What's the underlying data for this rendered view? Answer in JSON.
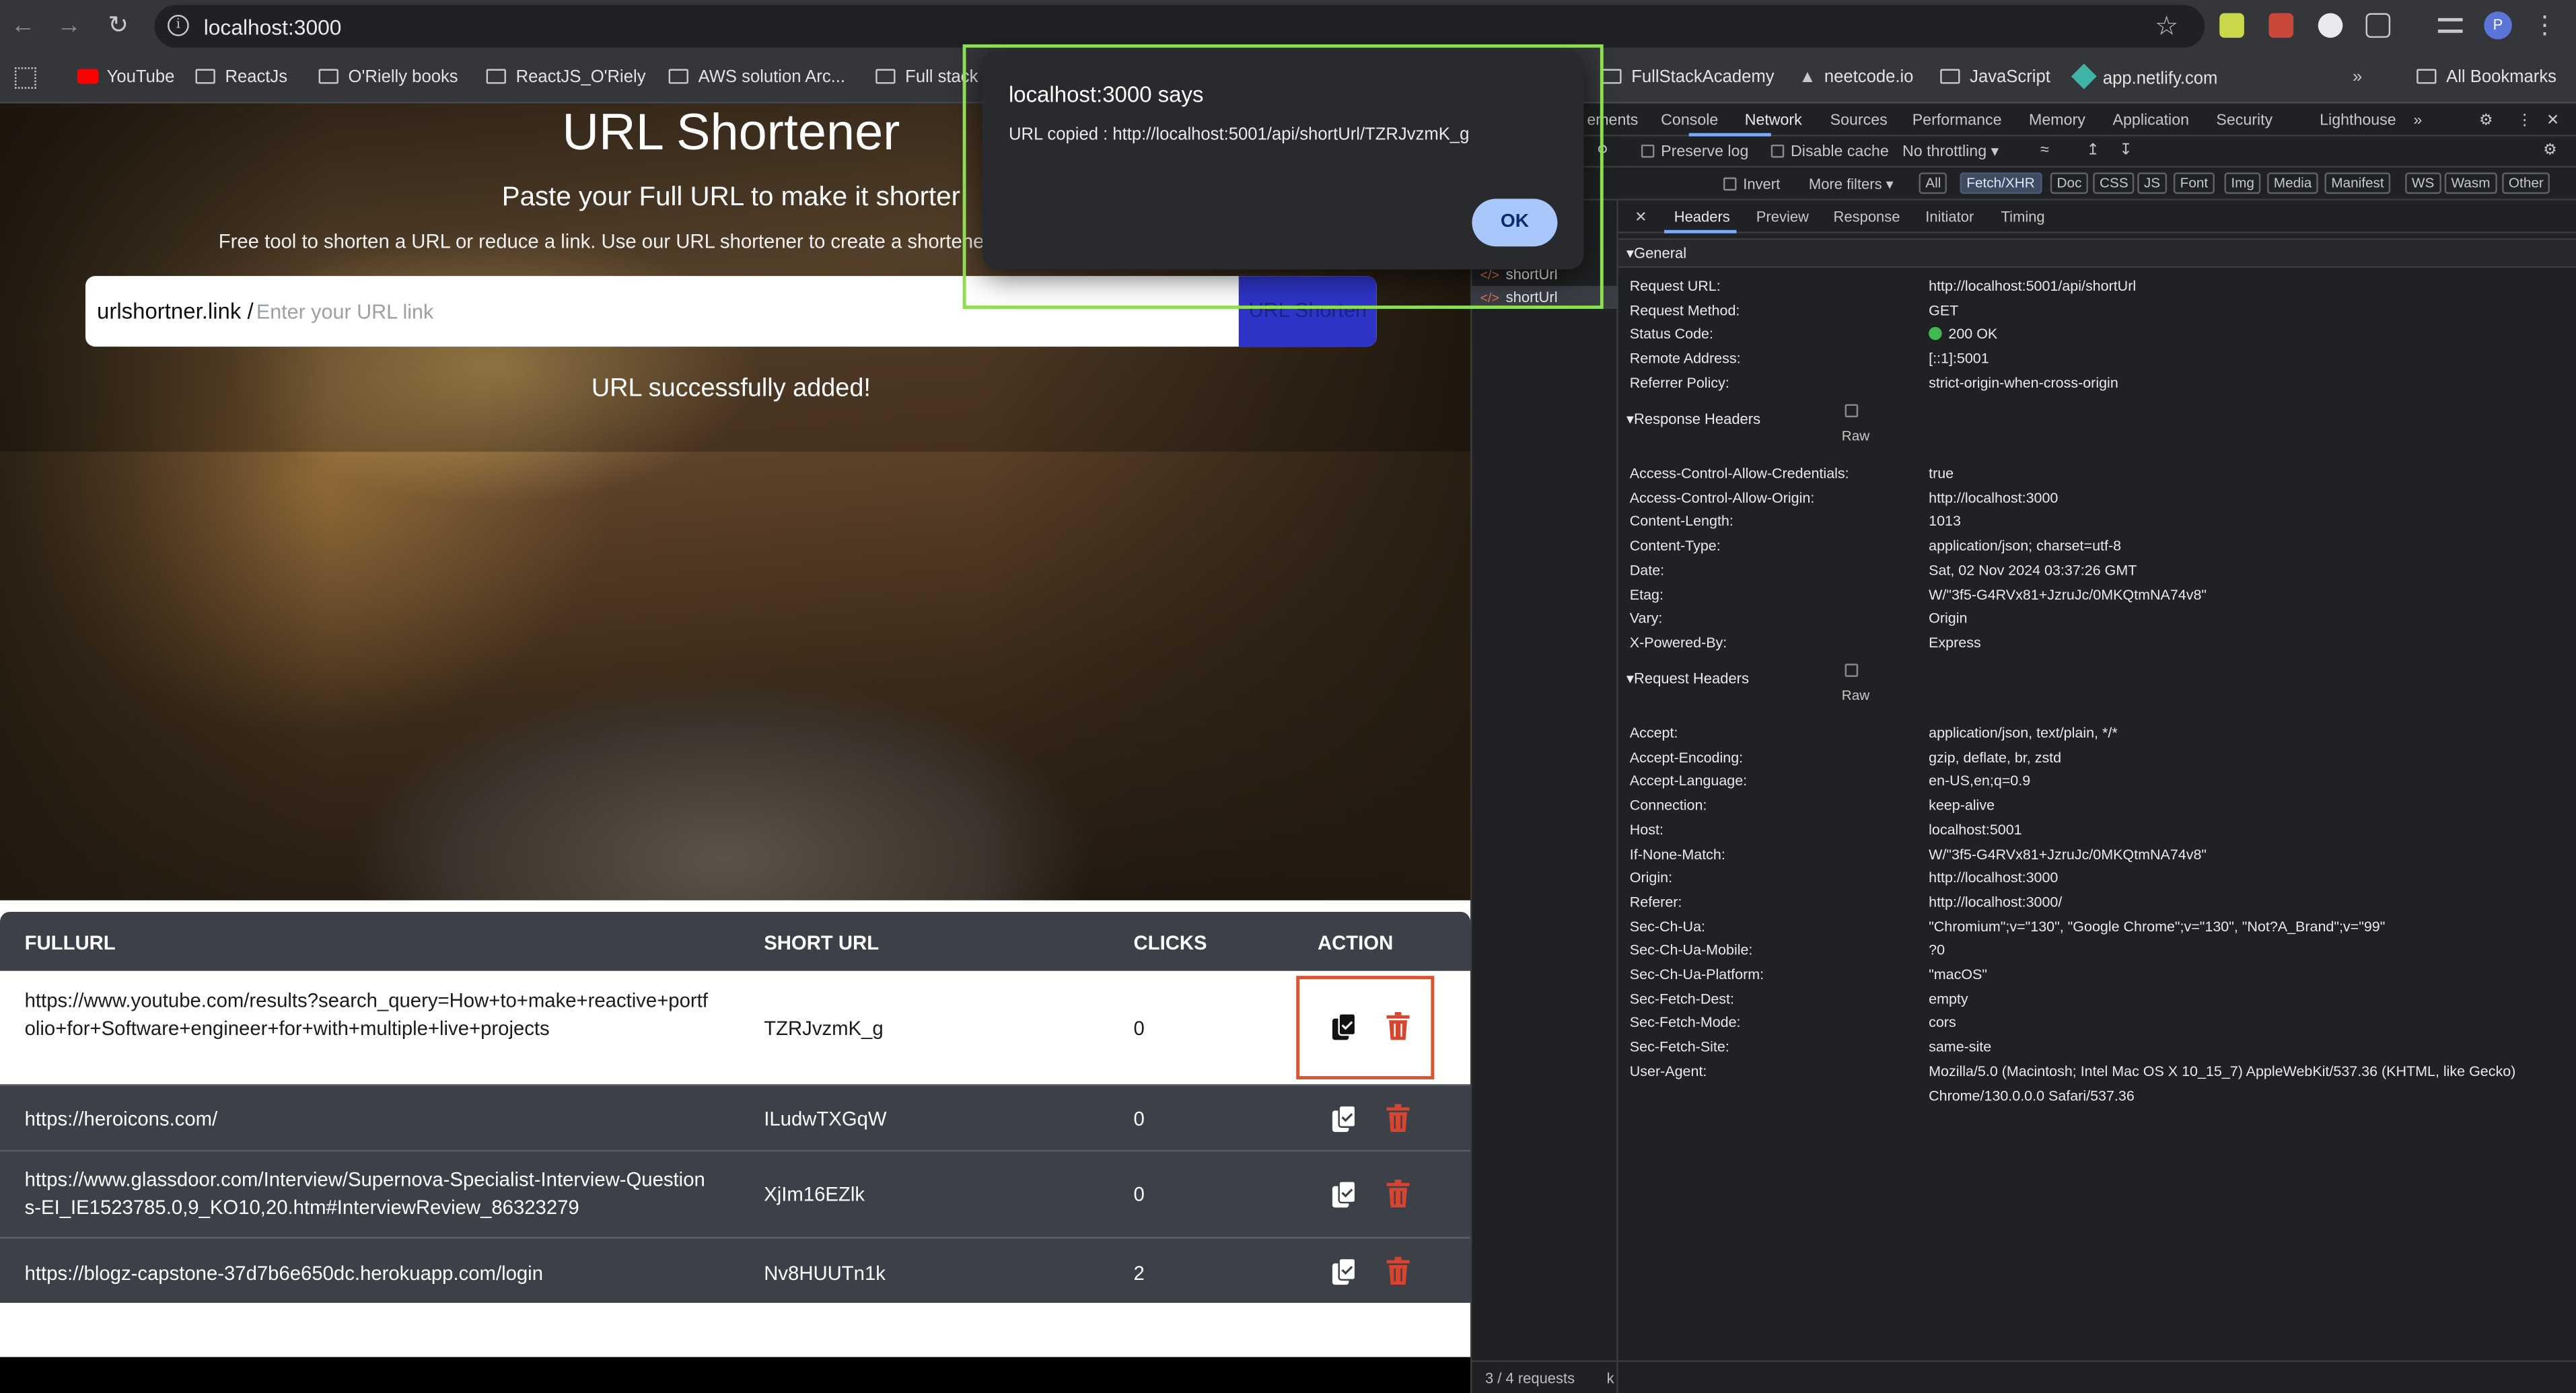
{
  "browser": {
    "url": "localhost:3000",
    "bookmarks": [
      {
        "label": "YouTube",
        "type": "youtube"
      },
      {
        "label": "ReactJs",
        "type": "folder"
      },
      {
        "label": "O'Rielly books",
        "type": "folder"
      },
      {
        "label": "ReactJS_O'Riely",
        "type": "folder"
      },
      {
        "label": "AWS solution Arc...",
        "type": "folder"
      },
      {
        "label": "Full stack",
        "type": "folder"
      },
      {
        "label": "FullStackAcademy",
        "type": "folder"
      },
      {
        "label": "neetcode.io",
        "type": "site"
      },
      {
        "label": "JavaScript",
        "type": "folder"
      },
      {
        "label": "app.netlify.com",
        "type": "site"
      }
    ],
    "all_bookmarks": "All Bookmarks",
    "profile_initial": "P"
  },
  "app": {
    "title": "URL Shortener",
    "subtitle": "Paste your Full URL to make it shorter",
    "description": "Free tool to shorten a URL or reduce a link. Use our URL shortener to create a shortened &",
    "domain_prefix": "urlshortner.link /",
    "input_placeholder": "Enter your URL link",
    "submit_label": "URL Shorten",
    "status_message": "URL successfully added!",
    "table": {
      "headers": [
        "FULLURL",
        "SHORT URL",
        "CLICKS",
        "ACTION"
      ],
      "rows": [
        {
          "full_url": "https://www.youtube.com/results?search_query=How+to+make+reactive+portfolio+for+Software+engineer+for+with+multiple+live+projects",
          "short_url": "TZRJvzmK_g",
          "clicks": "0"
        },
        {
          "full_url": "https://heroicons.com/",
          "short_url": "ILudwTXGqW",
          "clicks": "0"
        },
        {
          "full_url": "https://www.glassdoor.com/Interview/Supernova-Specialist-Interview-Questions-EI_IE1523785.0,9_KO10,20.htm#InterviewReview_86323279",
          "short_url": "XjIm16EZlk",
          "clicks": "0"
        },
        {
          "full_url": "https://blogz-capstone-37d7b6e650dc.herokuapp.com/login",
          "short_url": "Nv8HUUTn1k",
          "clicks": "2"
        }
      ]
    }
  },
  "dialog": {
    "title": "localhost:3000 says",
    "message": "URL copied : http://localhost:5001/api/shortUrl/TZRJvzmK_g",
    "ok_label": "OK"
  },
  "devtools": {
    "tabs": [
      "ements",
      "Console",
      "Network",
      "Sources",
      "Performance",
      "Memory",
      "Application",
      "Security",
      "Lighthouse"
    ],
    "active_tab": "Network",
    "toolbar": {
      "preserve_log": "Preserve log",
      "disable_cache": "Disable cache",
      "throttling": "No throttling"
    },
    "filter_bar": {
      "invert": "Invert",
      "more_filters": "More filters",
      "types": [
        "All",
        "Fetch/XHR",
        "Doc",
        "CSS",
        "JS",
        "Font",
        "Img",
        "Media",
        "Manifest",
        "WS",
        "Wasm",
        "Other"
      ],
      "active_type": "Fetch/XHR"
    },
    "requests": [
      {
        "name": "shortUrl",
        "selected": false
      },
      {
        "name": "shortUrl",
        "selected": true
      }
    ],
    "footer": "3 / 4 requests",
    "footer_tail": "k",
    "detail_tabs": [
      "Headers",
      "Preview",
      "Response",
      "Initiator",
      "Timing"
    ],
    "active_detail_tab": "Headers",
    "general": {
      "title": "General",
      "items": [
        {
          "k": "Request URL:",
          "v": "http://localhost:5001/api/shortUrl"
        },
        {
          "k": "Request Method:",
          "v": "GET"
        },
        {
          "k": "Status Code:",
          "v": "200 OK"
        },
        {
          "k": "Remote Address:",
          "v": "[::1]:5001"
        },
        {
          "k": "Referrer Policy:",
          "v": "strict-origin-when-cross-origin"
        }
      ]
    },
    "response_headers": {
      "title": "Response Headers",
      "raw_label": "Raw",
      "items": [
        {
          "k": "Access-Control-Allow-Credentials:",
          "v": "true"
        },
        {
          "k": "Access-Control-Allow-Origin:",
          "v": "http://localhost:3000"
        },
        {
          "k": "Content-Length:",
          "v": "1013"
        },
        {
          "k": "Content-Type:",
          "v": "application/json; charset=utf-8"
        },
        {
          "k": "Date:",
          "v": "Sat, 02 Nov 2024 03:37:26 GMT"
        },
        {
          "k": "Etag:",
          "v": "W/\"3f5-G4RVx81+JzruJc/0MKQtmNA74v8\""
        },
        {
          "k": "Vary:",
          "v": "Origin"
        },
        {
          "k": "X-Powered-By:",
          "v": "Express"
        }
      ]
    },
    "request_headers": {
      "title": "Request Headers",
      "raw_label": "Raw",
      "items": [
        {
          "k": "Accept:",
          "v": "application/json, text/plain, */*"
        },
        {
          "k": "Accept-Encoding:",
          "v": "gzip, deflate, br, zstd"
        },
        {
          "k": "Accept-Language:",
          "v": "en-US,en;q=0.9"
        },
        {
          "k": "Connection:",
          "v": "keep-alive"
        },
        {
          "k": "Host:",
          "v": "localhost:5001"
        },
        {
          "k": "If-None-Match:",
          "v": "W/\"3f5-G4RVx81+JzruJc/0MKQtmNA74v8\""
        },
        {
          "k": "Origin:",
          "v": "http://localhost:3000"
        },
        {
          "k": "Referer:",
          "v": "http://localhost:3000/"
        },
        {
          "k": "Sec-Ch-Ua:",
          "v": "\"Chromium\";v=\"130\", \"Google Chrome\";v=\"130\", \"Not?A_Brand\";v=\"99\""
        },
        {
          "k": "Sec-Ch-Ua-Mobile:",
          "v": "?0"
        },
        {
          "k": "Sec-Ch-Ua-Platform:",
          "v": "\"macOS\""
        },
        {
          "k": "Sec-Fetch-Dest:",
          "v": "empty"
        },
        {
          "k": "Sec-Fetch-Mode:",
          "v": "cors"
        },
        {
          "k": "Sec-Fetch-Site:",
          "v": "same-site"
        },
        {
          "k": "User-Agent:",
          "v": "Mozilla/5.0 (Macintosh; Intel Mac OS X 10_15_7) AppleWebKit/537.36 (KHTML, like Gecko) Chrome/130.0.0.0 Safari/537.36"
        }
      ]
    }
  }
}
